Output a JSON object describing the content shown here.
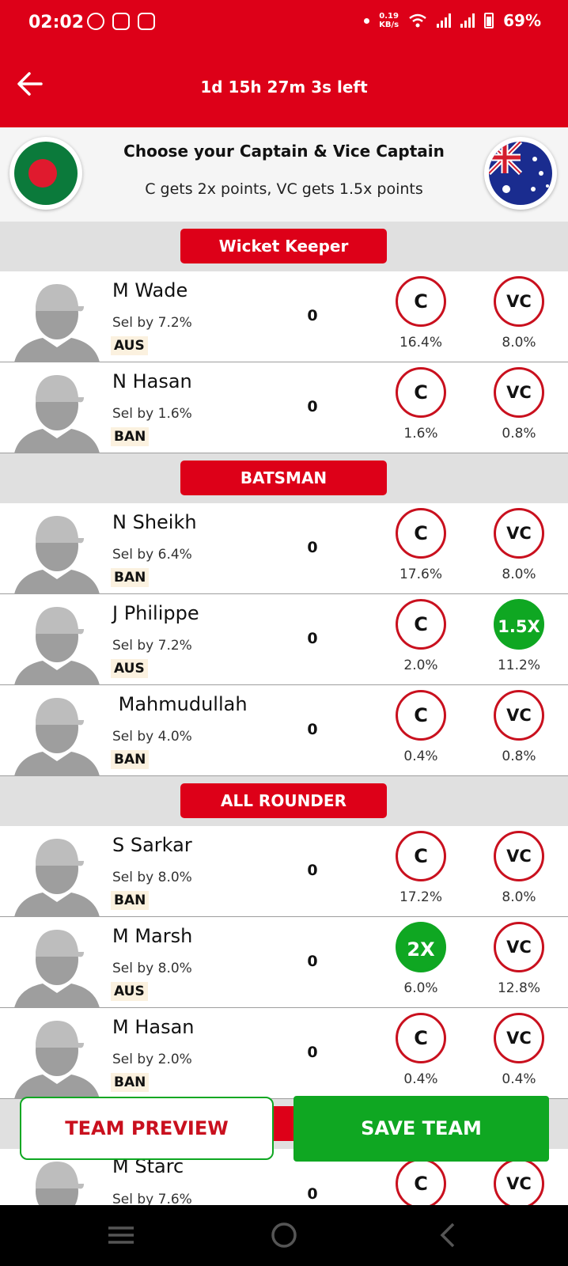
{
  "status_bar": {
    "time": "02:02",
    "network_speed_value": "0.19",
    "network_speed_unit": "KB/s",
    "battery": "69%",
    "icons": [
      "whatsapp-icon",
      "instagram-icon",
      "calendar-icon",
      "wifi-icon",
      "signal-icon",
      "signal-icon",
      "battery-icon"
    ]
  },
  "header": {
    "back_icon": "back-arrow-icon",
    "countdown": "1d 15h 27m 3s left"
  },
  "match_info": {
    "title": "Choose your Captain & Vice Captain",
    "subtitle": "C gets 2x points, VC gets 1.5x points",
    "left_team_flag": "bangladesh-flag-icon",
    "right_team_flag": "australia-flag-icon"
  },
  "sections": [
    "Wicket Keeper",
    "BATSMAN",
    "ALL ROUNDER"
  ],
  "players": [
    {
      "name": "M Wade",
      "sel": "Sel by 7.2%",
      "team": "AUS",
      "points": "0",
      "c_label": "C",
      "vc_label": "VC",
      "c_pct": "16.4%",
      "vc_pct": "8.0%",
      "c_selected": false,
      "vc_selected": false
    },
    {
      "name": "N Hasan",
      "sel": "Sel by 1.6%",
      "team": "BAN",
      "points": "0",
      "c_label": "C",
      "vc_label": "VC",
      "c_pct": "1.6%",
      "vc_pct": "0.8%",
      "c_selected": false,
      "vc_selected": false
    },
    {
      "name": "N Sheikh",
      "sel": "Sel by 6.4%",
      "team": "BAN",
      "points": "0",
      "c_label": "C",
      "vc_label": "VC",
      "c_pct": "17.6%",
      "vc_pct": "8.0%",
      "c_selected": false,
      "vc_selected": false
    },
    {
      "name": "J Philippe",
      "sel": "Sel by 7.2%",
      "team": "AUS",
      "points": "0",
      "c_label": "C",
      "vc_label": "1.5X",
      "c_pct": "2.0%",
      "vc_pct": "11.2%",
      "c_selected": false,
      "vc_selected": true
    },
    {
      "name": " Mahmudullah",
      "sel": "Sel by 4.0%",
      "team": "BAN",
      "points": "0",
      "c_label": "C",
      "vc_label": "VC",
      "c_pct": "0.4%",
      "vc_pct": "0.8%",
      "c_selected": false,
      "vc_selected": false
    },
    {
      "name": "S Sarkar",
      "sel": "Sel by 8.0%",
      "team": "BAN",
      "points": "0",
      "c_label": "C",
      "vc_label": "VC",
      "c_pct": "17.2%",
      "vc_pct": "8.0%",
      "c_selected": false,
      "vc_selected": false
    },
    {
      "name": "M Marsh",
      "sel": "Sel by 8.0%",
      "team": "AUS",
      "points": "0",
      "c_label": "2X",
      "vc_label": "VC",
      "c_pct": "6.0%",
      "vc_pct": "12.8%",
      "c_selected": true,
      "vc_selected": false
    },
    {
      "name": "M Hasan",
      "sel": "Sel by 2.0%",
      "team": "BAN",
      "points": "0",
      "c_label": "C",
      "vc_label": "VC",
      "c_pct": "0.4%",
      "vc_pct": "0.4%",
      "c_selected": false,
      "vc_selected": false
    },
    {
      "name": "M Starc",
      "sel": "Sel by 7.6%",
      "team": "",
      "points": "0",
      "c_label": "C",
      "vc_label": "VC",
      "c_pct": "",
      "vc_pct": "",
      "c_selected": false,
      "vc_selected": false
    }
  ],
  "actions": {
    "team_preview": "TEAM PREVIEW",
    "save_team": "SAVE TEAM"
  },
  "nav_bar": {
    "icons": [
      "recent-apps-icon",
      "home-icon",
      "back-icon"
    ]
  },
  "colors": {
    "brand_red": "#dd0018",
    "selected_green": "#0fa722",
    "section_gray": "#e0e0e0",
    "team_tag_bg": "#fbf1df"
  }
}
